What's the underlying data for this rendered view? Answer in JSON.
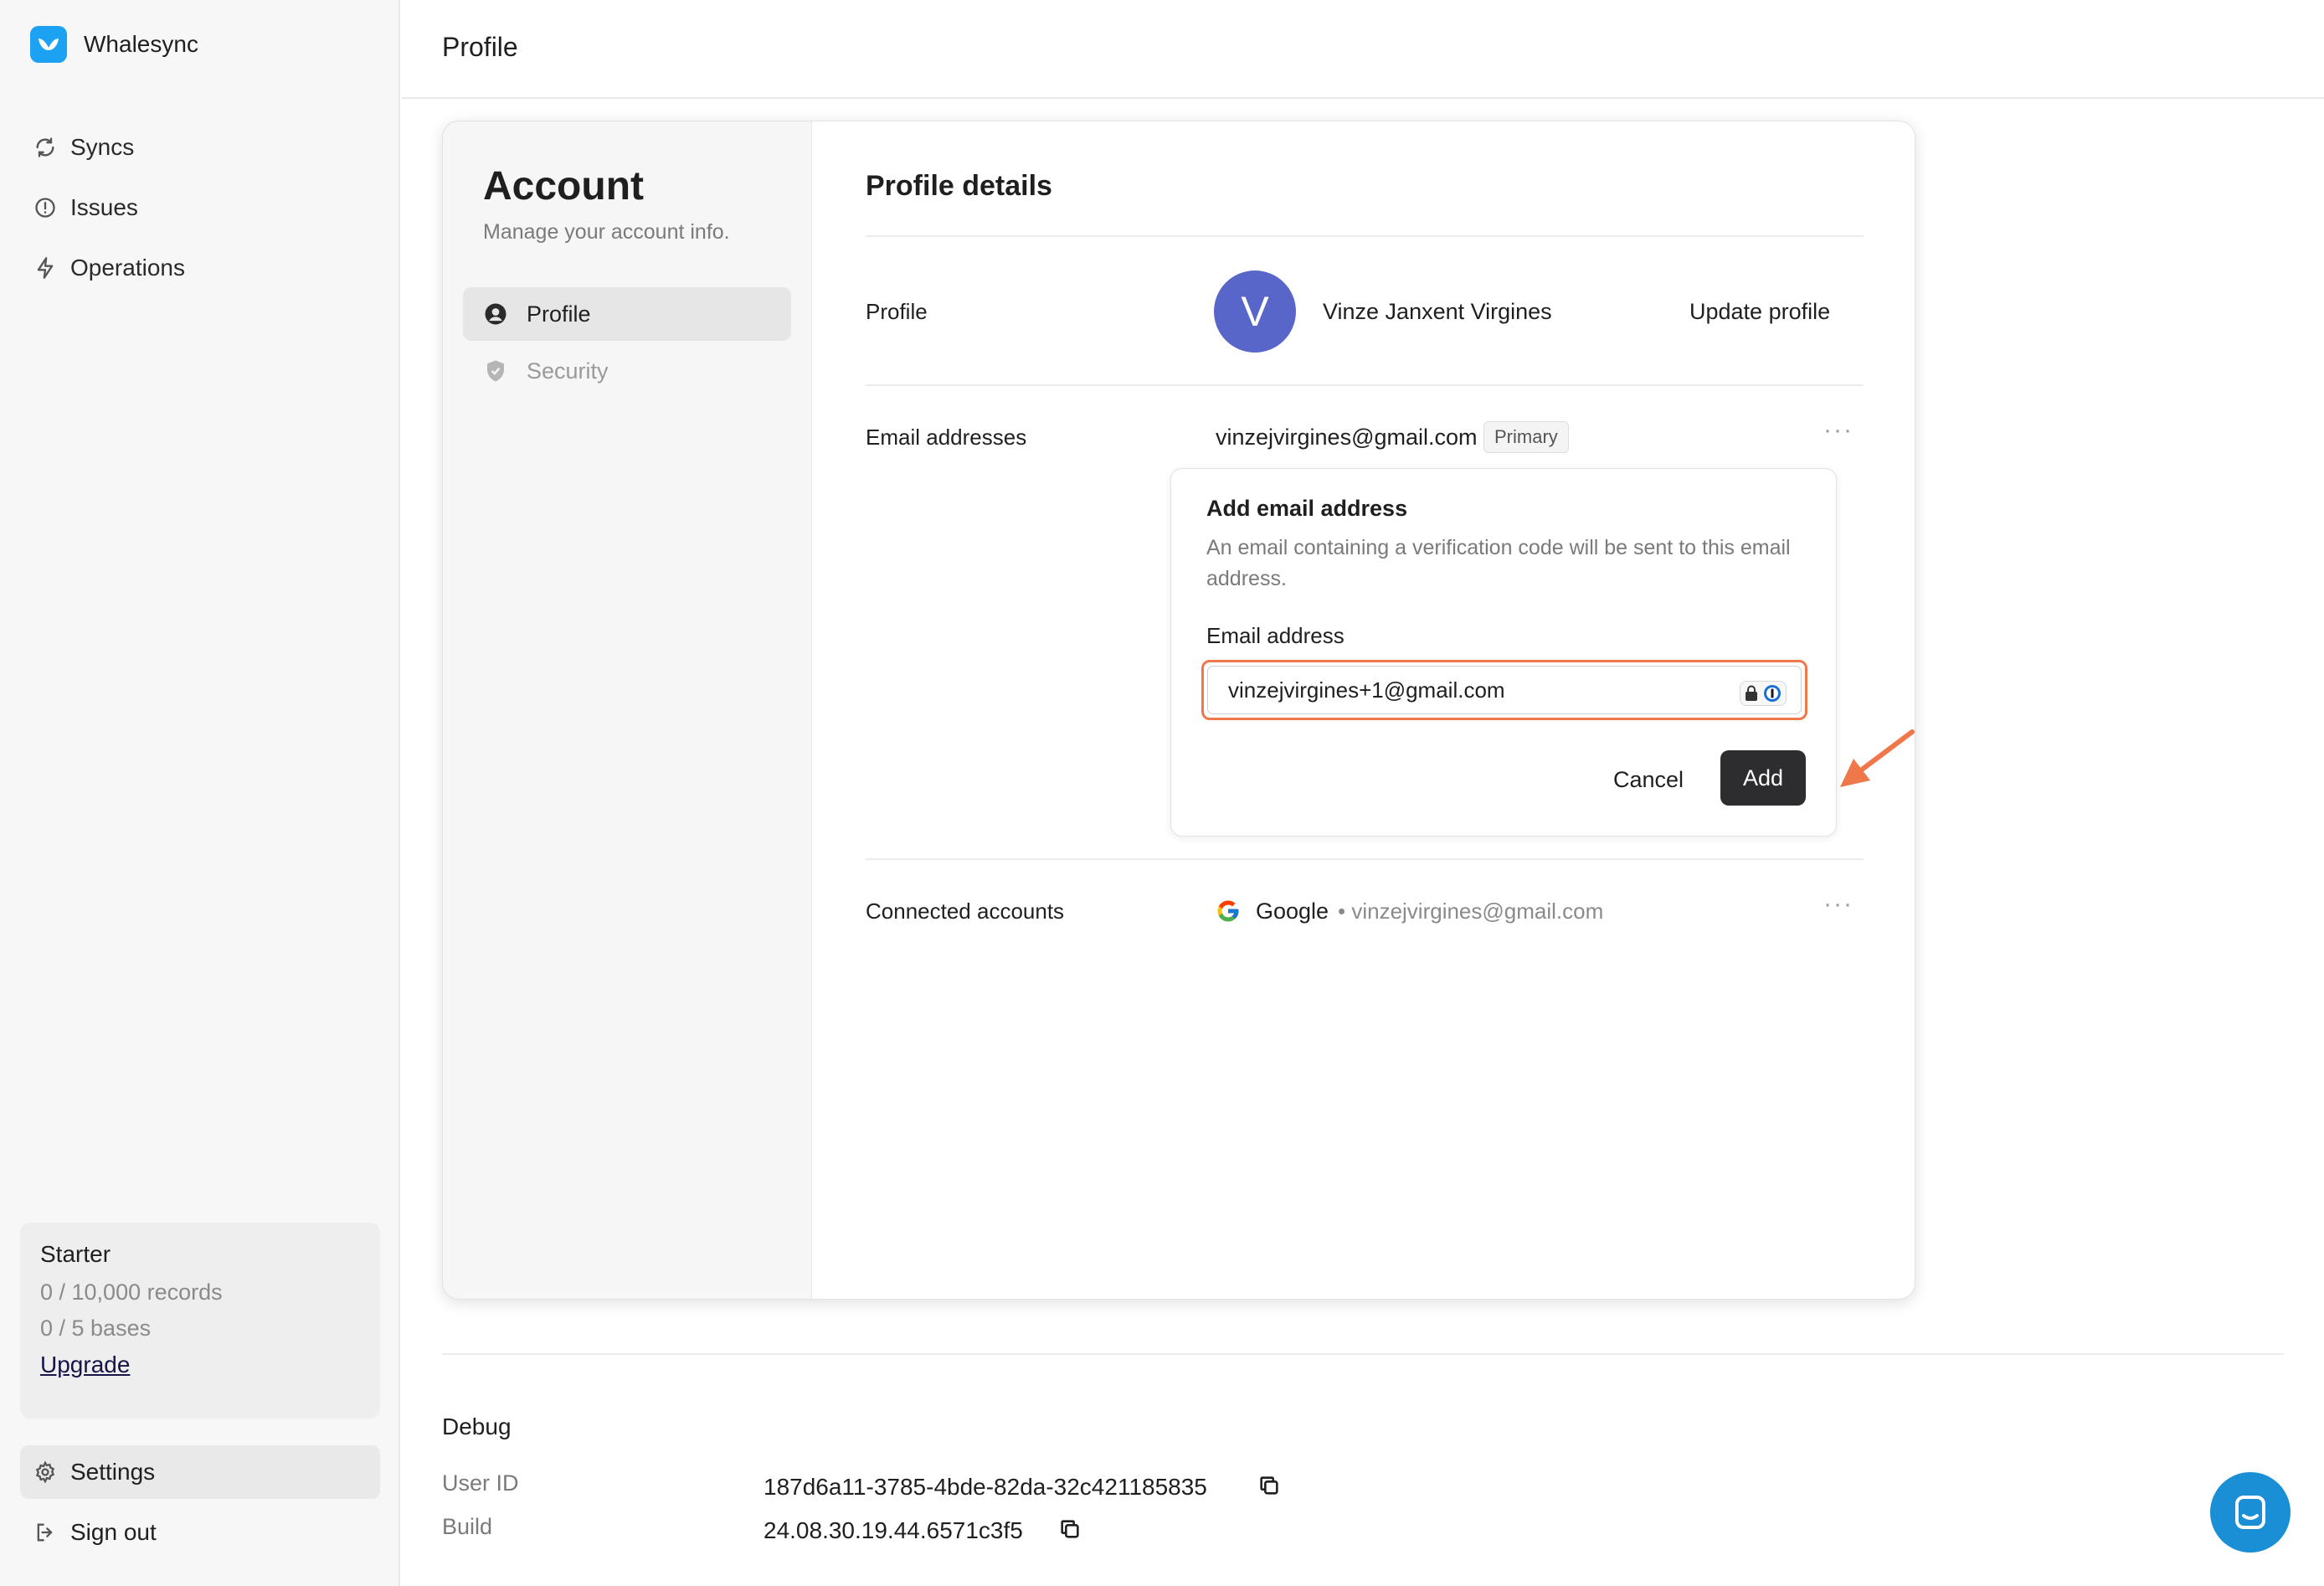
{
  "brand": {
    "name": "Whalesync"
  },
  "sidebar": {
    "items": [
      {
        "label": "Syncs",
        "icon": "refresh-icon"
      },
      {
        "label": "Issues",
        "icon": "alert-circle-icon"
      },
      {
        "label": "Operations",
        "icon": "lightning-icon"
      }
    ],
    "plan": {
      "title": "Starter",
      "records": "0 / 10,000 records",
      "bases": "0 / 5 bases",
      "upgrade_label": "Upgrade"
    },
    "settings_label": "Settings",
    "signout_label": "Sign out"
  },
  "header": {
    "title": "Profile"
  },
  "account": {
    "title": "Account",
    "subtitle": "Manage your account info.",
    "tabs": [
      {
        "label": "Profile",
        "icon": "user-circle-icon",
        "active": true
      },
      {
        "label": "Security",
        "icon": "shield-icon",
        "active": false
      }
    ]
  },
  "profile_details": {
    "title": "Profile details",
    "profile_label": "Profile",
    "avatar_initial": "V",
    "name": "Vinze Janxent Virgines",
    "update_label": "Update profile",
    "email_label": "Email addresses",
    "email": "vinzejvirgines@gmail.com",
    "primary_badge": "Primary",
    "more": "···",
    "connected_label": "Connected accounts",
    "google_name": "Google",
    "google_email": "• vinzejvirgines@gmail.com"
  },
  "add_email": {
    "title": "Add email address",
    "description": "An email containing a verification code will be sent to this email address.",
    "field_label": "Email address",
    "value": "vinzejvirgines+1@gmail.com",
    "cancel_label": "Cancel",
    "add_label": "Add"
  },
  "debug": {
    "title": "Debug",
    "user_id_label": "User ID",
    "user_id": "187d6a11-3785-4bde-82da-32c421185835",
    "build_label": "Build",
    "build": "24.08.30.19.44.6571c3f5"
  },
  "colors": {
    "accent_arrow": "#f0774a",
    "avatar_bg": "#5865c9",
    "brand_blue": "#1da1f2",
    "add_button_bg": "#2d2d30"
  }
}
